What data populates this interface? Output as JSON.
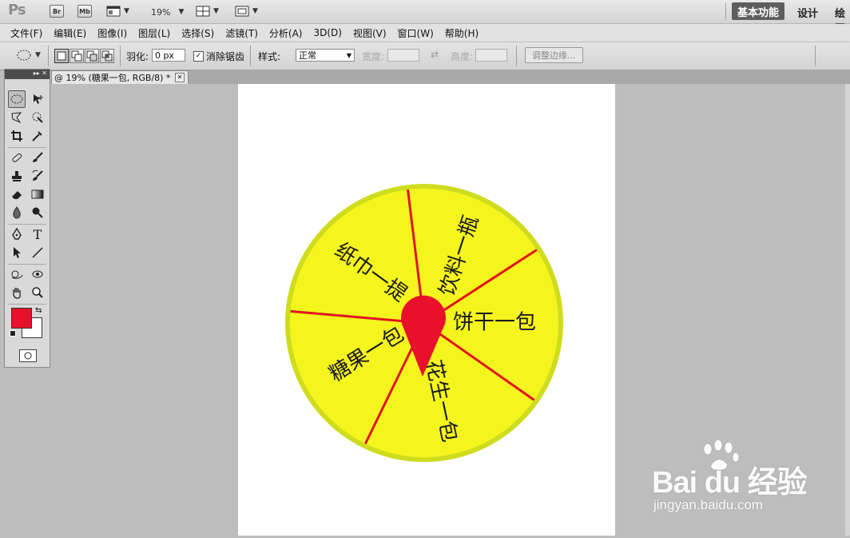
{
  "app": {
    "logo": "Ps",
    "bridge_label": "Br",
    "minibridge_label": "Mb",
    "zoom": "19%",
    "workspaces": [
      "基本功能",
      "设计",
      "绘画"
    ]
  },
  "menu": [
    "文件(F)",
    "编辑(E)",
    "图像(I)",
    "图层(L)",
    "选择(S)",
    "滤镜(T)",
    "分析(A)",
    "3D(D)",
    "视图(V)",
    "窗口(W)",
    "帮助(H)"
  ],
  "options": {
    "feather_label": "羽化:",
    "feather_value": "0 px",
    "antialias_label": "消除锯齿",
    "antialias_checked": true,
    "style_label": "样式:",
    "style_value": "正常",
    "width_label": "宽度:",
    "height_label": "高度:",
    "refine_edge_label": "调整边缘..."
  },
  "document": {
    "tab_title": "@ 19% (糖果一包, RGB/8) *",
    "wheel": {
      "fill_color": "#f5f51e",
      "rim_color": "#cfdc1e",
      "divider_color": "#e0141e",
      "pointer_color": "#e8102a",
      "segments": [
        "饮料一瓶",
        "饼干一包",
        "花生一包",
        "糖果一包",
        "纸巾一提"
      ]
    }
  },
  "colors": {
    "foreground": "#e8102a",
    "background": "#ffffff"
  },
  "watermark": {
    "brand": "Bai du 经验",
    "url": "jingyan.baidu.com"
  }
}
